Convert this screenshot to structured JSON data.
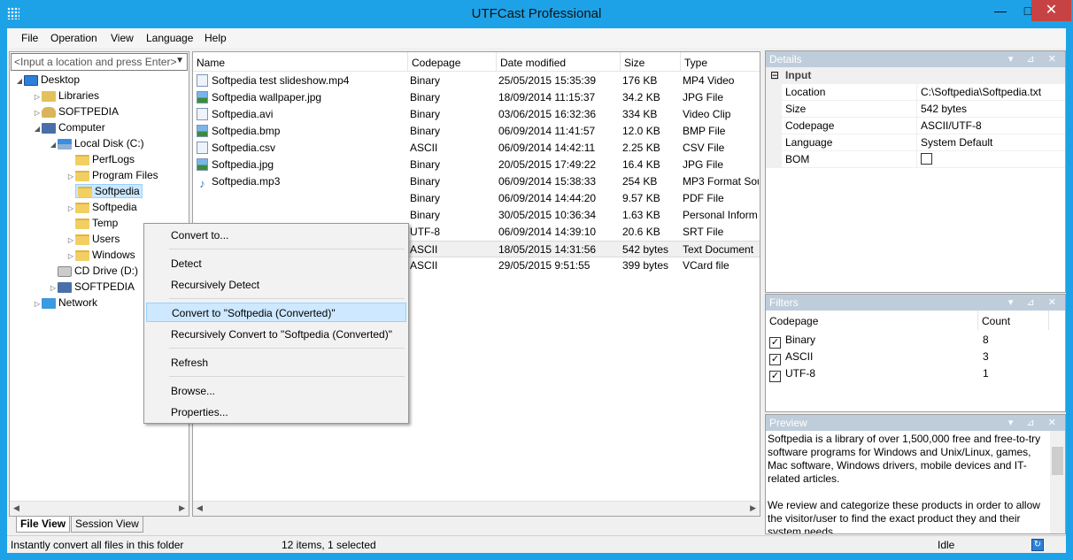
{
  "window": {
    "title": "UTFCast Professional",
    "minimize": "—",
    "maximize": "□",
    "close": "✕"
  },
  "menu": [
    "File",
    "Operation",
    "View",
    "Language",
    "Help"
  ],
  "location": {
    "placeholder": "<Input a location and press Enter>"
  },
  "tree": [
    {
      "label": "Desktop",
      "icon": "desktop-icon",
      "expand": "◢"
    },
    {
      "label": "Libraries",
      "icon": "libraries-icon",
      "expand": "▷"
    },
    {
      "label": "SOFTPEDIA",
      "icon": "user-folder-icon",
      "expand": "▷"
    },
    {
      "label": "Computer",
      "icon": "computer-icon",
      "expand": "◢"
    },
    {
      "label": "Local Disk (C:)",
      "icon": "disk-icon",
      "expand": "◢"
    },
    {
      "label": "PerfLogs",
      "icon": "folder-icon",
      "expand": ""
    },
    {
      "label": "Program Files",
      "icon": "folder-icon",
      "expand": "▷"
    },
    {
      "label": "Softpedia",
      "icon": "folder-icon",
      "expand": ""
    },
    {
      "label": "Softpedia",
      "icon": "folder-icon",
      "expand": "▷"
    },
    {
      "label": "Temp",
      "icon": "folder-icon",
      "expand": ""
    },
    {
      "label": "Users",
      "icon": "folder-icon",
      "expand": "▷"
    },
    {
      "label": "Windows",
      "icon": "folder-icon",
      "expand": "▷"
    },
    {
      "label": "CD Drive (D:)",
      "icon": "cd-icon",
      "expand": ""
    },
    {
      "label": "SOFTPEDIA",
      "icon": "network-drive-icon",
      "expand": "▷"
    },
    {
      "label": "Network",
      "icon": "network-icon",
      "expand": "▷"
    }
  ],
  "tabs": [
    "File View",
    "Session View"
  ],
  "files": {
    "columns": [
      "Name",
      "Codepage",
      "Date modified",
      "Size",
      "Type"
    ],
    "rows": [
      {
        "name": "Softpedia test slideshow.mp4",
        "codepage": "Binary",
        "date": "25/05/2015 15:35:39",
        "size": "176 KB",
        "type": "MP4 Video",
        "icon": "video-file-icon"
      },
      {
        "name": "Softpedia wallpaper.jpg",
        "codepage": "Binary",
        "date": "18/09/2014 11:15:37",
        "size": "34.2 KB",
        "type": "JPG File",
        "icon": "image-file-icon"
      },
      {
        "name": "Softpedia.avi",
        "codepage": "Binary",
        "date": "03/06/2015 16:32:36",
        "size": "334 KB",
        "type": "Video Clip",
        "icon": "video-file-icon"
      },
      {
        "name": "Softpedia.bmp",
        "codepage": "Binary",
        "date": "06/09/2014 11:41:57",
        "size": "12.0 KB",
        "type": "BMP File",
        "icon": "image-file-icon"
      },
      {
        "name": "Softpedia.csv",
        "codepage": "ASCII",
        "date": "06/09/2014 14:42:11",
        "size": "2.25 KB",
        "type": "CSV File",
        "icon": "text-file-icon"
      },
      {
        "name": "Softpedia.jpg",
        "codepage": "Binary",
        "date": "20/05/2015 17:49:22",
        "size": "16.4 KB",
        "type": "JPG File",
        "icon": "image-file-icon"
      },
      {
        "name": "Softpedia.mp3",
        "codepage": "Binary",
        "date": "06/09/2014 15:38:33",
        "size": "254 KB",
        "type": "MP3 Format Sou",
        "icon": "audio-file-icon"
      },
      {
        "name": "",
        "codepage": "Binary",
        "date": "06/09/2014 14:44:20",
        "size": "9.57 KB",
        "type": "PDF File",
        "icon": "pdf-file-icon"
      },
      {
        "name": "",
        "codepage": "Binary",
        "date": "30/05/2015 10:36:34",
        "size": "1.63 KB",
        "type": "Personal Inform",
        "icon": "file-icon"
      },
      {
        "name": "",
        "codepage": "UTF-8",
        "date": "06/09/2014 14:39:10",
        "size": "20.6 KB",
        "type": "SRT File",
        "icon": "file-icon"
      },
      {
        "name": "",
        "codepage": "ASCII",
        "date": "18/05/2015 14:31:56",
        "size": "542 bytes",
        "type": "Text Document",
        "icon": "text-file-icon"
      },
      {
        "name": "",
        "codepage": "ASCII",
        "date": "29/05/2015 9:51:55",
        "size": "399 bytes",
        "type": "VCard file",
        "icon": "file-icon"
      }
    ]
  },
  "context_menu": {
    "convert_to": "Convert to...",
    "detect": "Detect",
    "recursively_detect": "Recursively Detect",
    "convert_to_softpedia": "Convert to \"Softpedia (Converted)\"",
    "recursively_convert": "Recursively Convert to \"Softpedia (Converted)\"",
    "refresh": "Refresh",
    "browse": "Browse...",
    "properties": "Properties..."
  },
  "details": {
    "title": "Details",
    "group": "Input",
    "group_toggle": "⊟",
    "props": [
      {
        "name": "Location",
        "value": "C:\\Softpedia\\Softpedia.txt"
      },
      {
        "name": "Size",
        "value": "542 bytes"
      },
      {
        "name": "Codepage",
        "value": "ASCII/UTF-8"
      },
      {
        "name": "Language",
        "value": "System Default"
      },
      {
        "name": "BOM",
        "value": ""
      }
    ]
  },
  "filters": {
    "title": "Filters",
    "columns": [
      "Codepage",
      "Count"
    ],
    "rows": [
      {
        "name": "Binary",
        "count": "8",
        "checked": "✓"
      },
      {
        "name": "ASCII",
        "count": "3",
        "checked": "✓"
      },
      {
        "name": "UTF-8",
        "count": "1",
        "checked": "✓"
      }
    ]
  },
  "preview": {
    "title": "Preview",
    "paragraphs": [
      "Softpedia is a library of over 1,500,000 free and free-to-try software programs for Windows and Unix/Linux, games, Mac software, Windows drivers, mobile devices and IT-related articles.",
      "We review and categorize these products in order to allow the visitor/user to find the exact product they and their system needs."
    ]
  },
  "panel_buttons": "▾ ⊿ ✕",
  "status": {
    "hint": "Instantly convert all files in this folder",
    "count": "12 items, 1 selected",
    "state": "Idle"
  },
  "colors": {
    "titlebar": "#1ea2e7",
    "close": "#c74343",
    "selection": "#cce8ff",
    "panel_title": "#bfcddb"
  }
}
